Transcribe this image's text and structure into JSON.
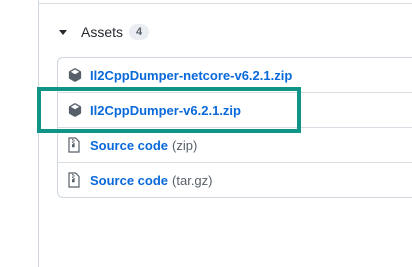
{
  "assets": {
    "title": "Assets",
    "count": "4",
    "items": [
      {
        "label": "Il2CppDumper-netcore-v6.2.1.zip",
        "icon": "package-icon"
      },
      {
        "label": "Il2CppDumper-v6.2.1.zip",
        "icon": "package-icon"
      },
      {
        "label": "Source code",
        "suffix": "(zip)",
        "icon": "file-zip-icon"
      },
      {
        "label": "Source code",
        "suffix": "(tar.gz)",
        "icon": "file-zip-icon"
      }
    ]
  },
  "colors": {
    "link": "#0969da",
    "highlight": "#109487",
    "muted": "#57606a"
  }
}
